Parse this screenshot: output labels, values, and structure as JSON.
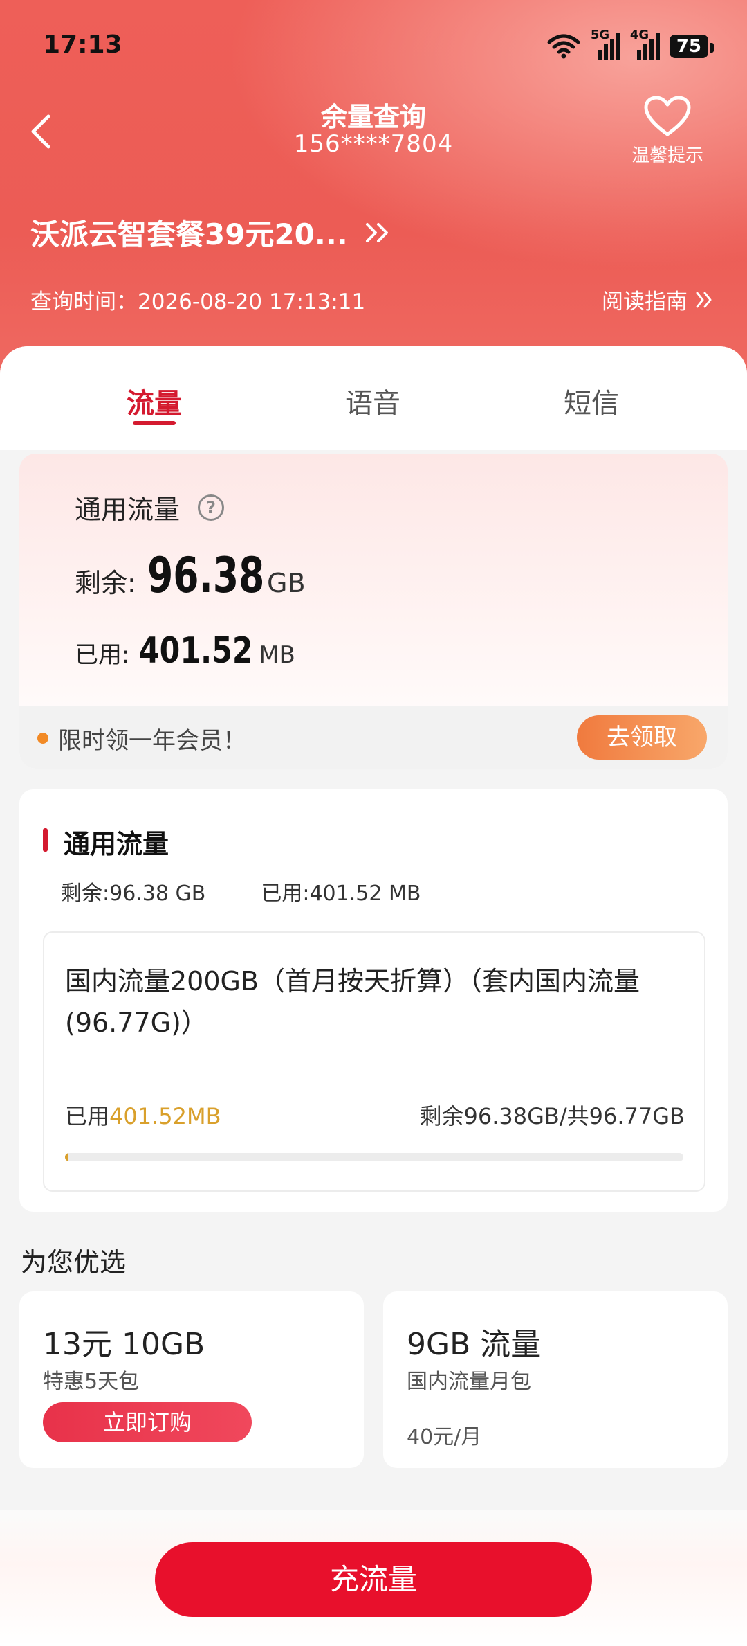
{
  "status_bar": {
    "time": "17:13",
    "net1": "5G",
    "net2": "4G",
    "battery": "75"
  },
  "header": {
    "title": "余量查询",
    "phone": "156****7804",
    "tips_label": "温馨提示",
    "plan_name": "沃派云智套餐39元20...",
    "query_time": "查询时间：2026-08-20 17:13:11",
    "guide_label": "阅读指南"
  },
  "tabs": [
    {
      "label": "流量",
      "active": true
    },
    {
      "label": "语音",
      "active": false
    },
    {
      "label": "短信",
      "active": false
    }
  ],
  "usage_card": {
    "title": "通用流量",
    "remain_label": "剩余:",
    "remain_value": "96.38",
    "remain_unit": "GB",
    "used_label": "已用:",
    "used_value": "401.52",
    "used_unit": "MB",
    "promo_text": "限时领一年会员！",
    "claim_label": "去领取"
  },
  "detail_card": {
    "title": "通用流量",
    "remain_stat": "剩余:96.38 GB",
    "used_stat": "已用:401.52 MB",
    "description": "国内流量200GB（首月按天折算）（套内国内流量(96.77G)）",
    "used_prefix": "已用",
    "used_amount": "401.52MB",
    "remain_total": "剩余96.38GB/共96.77GB",
    "progress_used_fraction": 0.004
  },
  "recommend": {
    "title": "为您优选",
    "cards": [
      {
        "title": "13元 10GB",
        "subtitle": "特惠5天包",
        "button": "立即订购"
      },
      {
        "title": "9GB 流量",
        "subtitle": "国内流量月包",
        "price": "40元/月"
      }
    ]
  },
  "bottom": {
    "recharge_label": "充流量"
  },
  "colors": {
    "brand_red": "#e8102c",
    "accent_gold": "#d9a02c",
    "header_red": "#ee5f58"
  }
}
